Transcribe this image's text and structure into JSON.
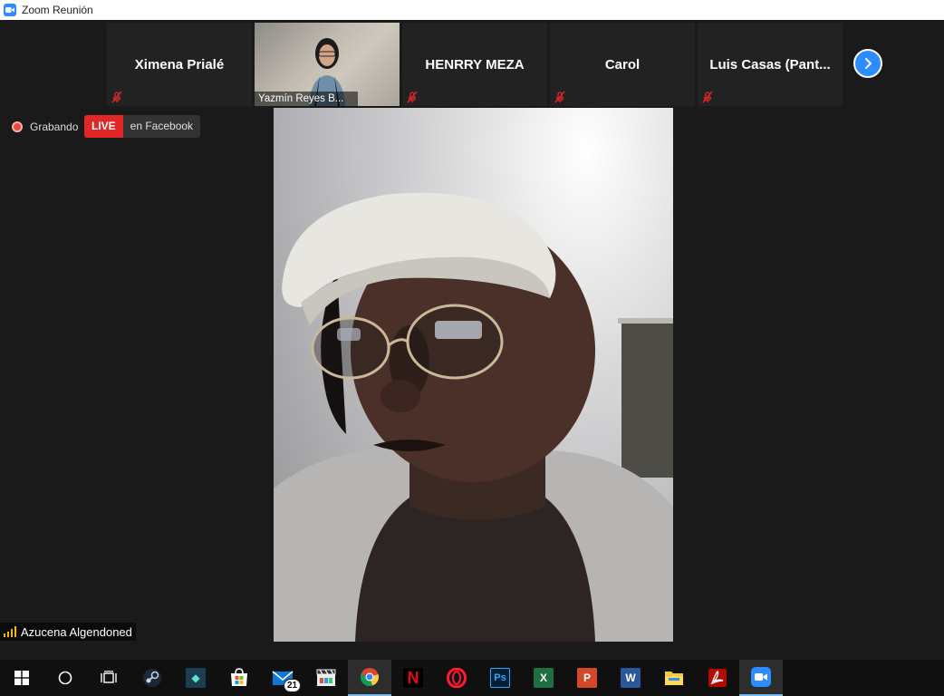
{
  "window": {
    "title": "Zoom Reunión"
  },
  "gallery": {
    "participants": [
      {
        "name": "Ximena Prialé",
        "muted": true
      },
      {
        "name": "Yazmín Reyes B...",
        "video": true
      },
      {
        "name": "HENRRY MEZA",
        "muted": true
      },
      {
        "name": "Carol",
        "muted": true
      },
      {
        "name": "Luis Casas (Pant...",
        "muted": true
      }
    ],
    "next_icon": "chevron-right-icon"
  },
  "recording": {
    "label": "Grabando",
    "color": "#e8473a"
  },
  "live": {
    "tag": "LIVE",
    "platform": "en Facebook",
    "color": "#e02828"
  },
  "active_speaker": {
    "name": "Azucena Algendoned"
  },
  "taskbar": {
    "apps": [
      {
        "icon": "windows-start-icon"
      },
      {
        "icon": "search-circle-icon"
      },
      {
        "icon": "task-view-icon"
      },
      {
        "icon": "steam-icon"
      },
      {
        "icon": "filmora-icon"
      },
      {
        "icon": "microsoft-store-icon"
      },
      {
        "icon": "mail-icon",
        "badge": "21"
      },
      {
        "icon": "video-editor-icon"
      },
      {
        "icon": "chrome-icon"
      },
      {
        "icon": "netflix-icon",
        "text": "N"
      },
      {
        "icon": "opera-icon"
      },
      {
        "icon": "photoshop-icon",
        "text": "Ps"
      },
      {
        "icon": "excel-icon",
        "text": "X"
      },
      {
        "icon": "powerpoint-icon",
        "text": "P"
      },
      {
        "icon": "word-icon",
        "text": "W"
      },
      {
        "icon": "file-explorer-icon"
      },
      {
        "icon": "acrobat-icon"
      },
      {
        "icon": "zoom-icon"
      }
    ]
  },
  "colors": {
    "zoom_blue": "#2d8cff",
    "background": "#1a1a1a",
    "tile": "#222222",
    "mute_red": "#e02828"
  }
}
